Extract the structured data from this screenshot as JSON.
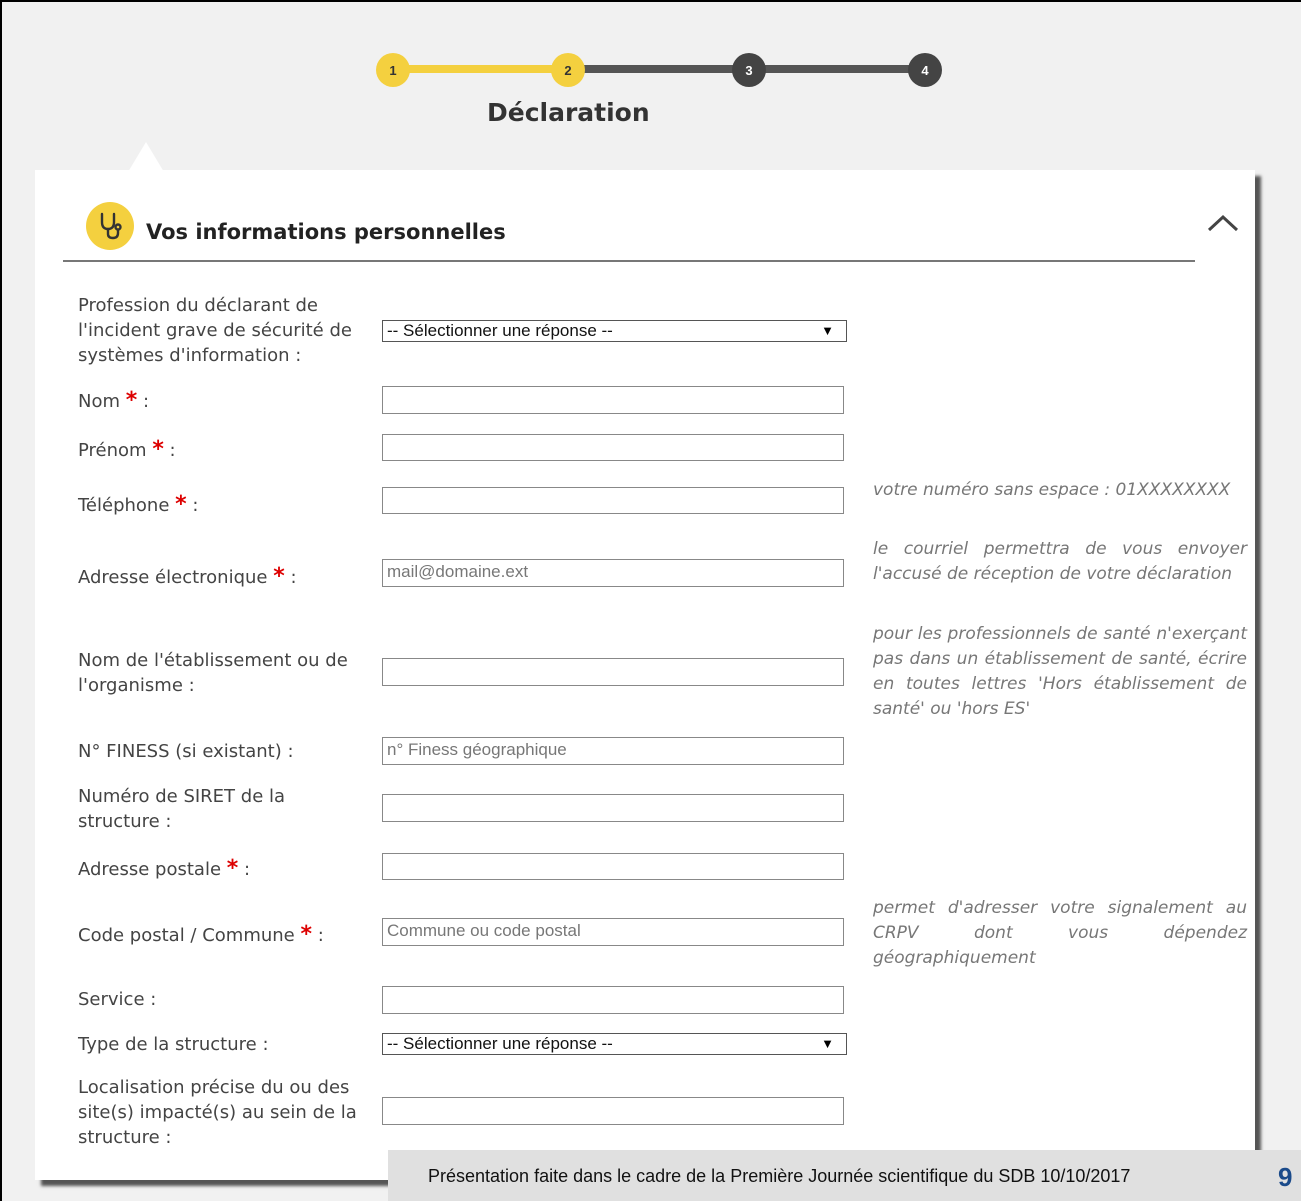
{
  "stepper": {
    "steps": [
      "1",
      "2",
      "3",
      "4"
    ],
    "current": 2,
    "title": "Déclaration"
  },
  "section": {
    "title": "Vos informations personnelles",
    "icon": "stethoscope-icon",
    "collapse_icon": "chevron-up-icon"
  },
  "colors": {
    "accent": "#f4d03f",
    "required": "#dd0000"
  },
  "form": {
    "profession": {
      "label": "Profession du déclarant de l'incident grave de sécurité de systèmes d'information :",
      "value": "-- Sélectionner une réponse --"
    },
    "nom": {
      "label": "Nom",
      "value": ""
    },
    "prenom": {
      "label": "Prénom",
      "value": ""
    },
    "telephone": {
      "label": "Téléphone",
      "value": "",
      "help": "votre numéro sans espace : 01XXXXXXXX"
    },
    "email": {
      "label": "Adresse électronique",
      "placeholder": "mail@domaine.ext",
      "help": "le courriel permettra de vous envoyer l'accusé de réception de votre déclaration"
    },
    "etablissement": {
      "label": "Nom de l'établissement ou de l'organisme :",
      "value": "",
      "help": "pour les professionnels de santé n'exerçant pas dans un établissement de santé, écrire en toutes lettres 'Hors établissement de santé' ou 'hors ES'"
    },
    "finess": {
      "label": "N° FINESS (si existant) :",
      "placeholder": "n° Finess géographique"
    },
    "siret": {
      "label": "Numéro de SIRET de la structure :",
      "value": ""
    },
    "adresse": {
      "label": "Adresse postale",
      "value": ""
    },
    "commune": {
      "label": "Code postal / Commune",
      "placeholder": "Commune ou code postal",
      "help": "permet d'adresser votre signalement au CRPV dont vous dépendez géographiquement"
    },
    "service": {
      "label": "Service :",
      "value": ""
    },
    "type_structure": {
      "label": "Type de la structure :",
      "value": "-- Sélectionner une réponse --"
    },
    "localisation": {
      "label": "Localisation précise du ou des site(s) impacté(s) au sein de la structure :",
      "value": ""
    }
  },
  "footer": {
    "text": "Présentation faite dans le cadre de la Première Journée scientifique du SDB 10/10/2017",
    "page": "9"
  }
}
